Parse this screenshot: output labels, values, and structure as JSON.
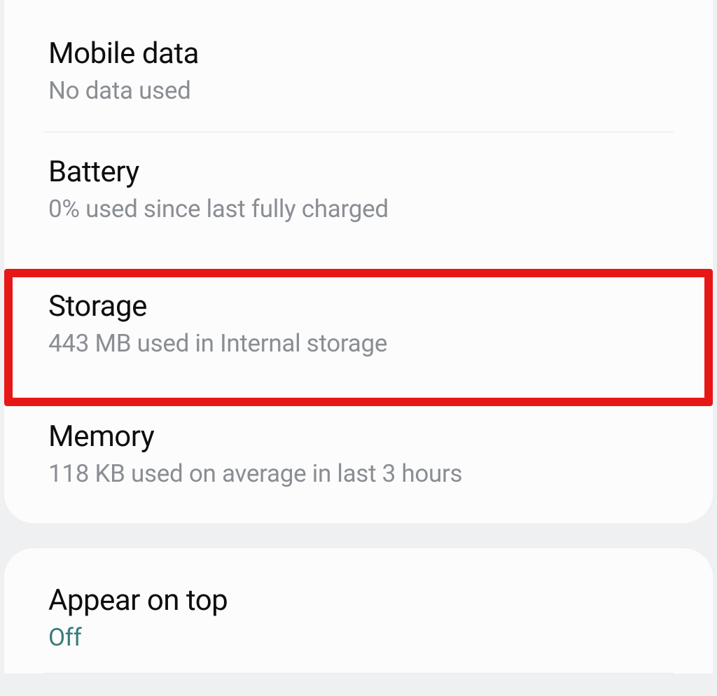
{
  "card1": {
    "mobile_data": {
      "title": "Mobile data",
      "subtitle": "No data used"
    },
    "battery": {
      "title": "Battery",
      "subtitle": "0% used since last fully charged"
    },
    "storage": {
      "title": "Storage",
      "subtitle": "443 MB used in Internal storage"
    },
    "memory": {
      "title": "Memory",
      "subtitle": "118 KB used on average in last 3 hours"
    }
  },
  "card2": {
    "appear_on_top": {
      "title": "Appear on top",
      "subtitle": "Off"
    }
  }
}
